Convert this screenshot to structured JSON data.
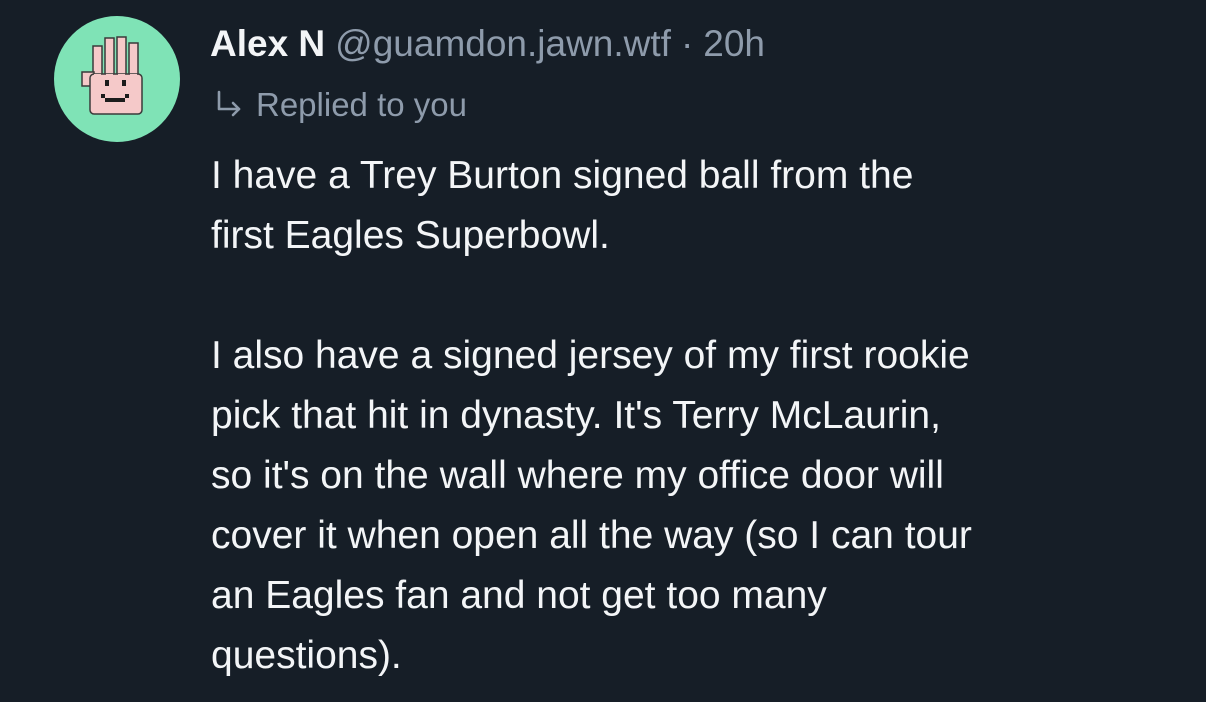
{
  "post": {
    "author": {
      "name": "Alex N",
      "handle": "@guamdon.jawn.wtf",
      "avatar_icon": "waving-hand-smiley-icon",
      "avatar_bg": "#7fe3b6"
    },
    "separator": "·",
    "timestamp": "20h",
    "reply_indicator": {
      "icon": "reply-arrow-icon",
      "label": "Replied to you"
    },
    "body": {
      "paragraphs": [
        {
          "lines": [
            "I have a Trey Burton signed ball from the",
            "first Eagles Superbowl."
          ]
        },
        {
          "lines": [
            "I also have a signed jersey of my first rookie",
            "pick that hit in dynasty. It's Terry McLaurin,",
            "so it's on the wall where my office door will",
            "cover it when open all the way (so I can tour",
            "an Eagles fan and not get too many",
            "questions)."
          ]
        }
      ]
    }
  },
  "colors": {
    "background": "#161e27",
    "text_primary": "#f3f5f7",
    "text_secondary": "#8e9bab"
  }
}
